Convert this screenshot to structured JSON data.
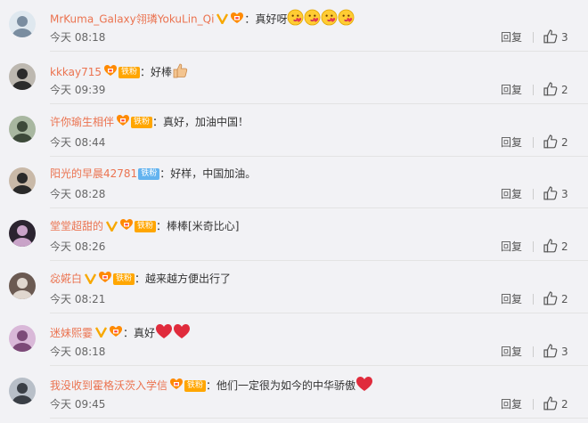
{
  "comments": [
    {
      "user": "MrKuma_Galaxy翎璘YokuLin_Qi",
      "verified": true,
      "fan_icon": true,
      "fan_label": "",
      "sep": "：",
      "text": "真好呀",
      "emojis": [
        "kiss",
        "kiss",
        "kiss",
        "kiss"
      ],
      "time": "今天 08:18",
      "reply": "回复",
      "likes": "3"
    },
    {
      "user": "kkkay715",
      "verified": false,
      "fan_icon": true,
      "fan_label": "铁粉",
      "sep": "：",
      "text": "好棒",
      "emojis": [
        "thumb"
      ],
      "time": "今天 09:39",
      "reply": "回复",
      "likes": "2"
    },
    {
      "user": "许你瑜生相伴",
      "verified": false,
      "fan_icon": true,
      "fan_label": "铁粉",
      "sep": "：",
      "text": "真好，加油中国！",
      "emojis": [],
      "time": "今天 08:44",
      "reply": "回复",
      "likes": "2"
    },
    {
      "user": "阳光的早晨42781",
      "verified": false,
      "fan_icon": false,
      "fan_label": "铁粉",
      "sep": "：",
      "text": "好样，中国加油。",
      "emojis": [],
      "time": "今天 08:28",
      "reply": "回复",
      "likes": "3"
    },
    {
      "user": "堂堂超甜的",
      "verified": true,
      "fan_icon": true,
      "fan_label": "铁粉",
      "sep": "：",
      "text": "棒棒[米奇比心]",
      "emojis": [],
      "time": "今天 08:26",
      "reply": "回复",
      "likes": "2"
    },
    {
      "user": "惢婲白",
      "verified": true,
      "fan_icon": true,
      "fan_label": "铁粉",
      "sep": "：",
      "text": "越来越方便出行了",
      "emojis": [],
      "time": "今天 08:21",
      "reply": "回复",
      "likes": "2"
    },
    {
      "user": "迷妹熙霎",
      "verified": true,
      "fan_icon": true,
      "fan_label": "",
      "sep": "：",
      "text": "真好",
      "emojis": [
        "heart",
        "heart"
      ],
      "time": "今天 08:18",
      "reply": "回复",
      "likes": "3"
    },
    {
      "user": "我没收到霍格沃茨入学信",
      "verified": false,
      "fan_icon": true,
      "fan_label": "铁粉",
      "sep": "：",
      "text": "他们一定很为如今的中华骄傲",
      "emojis": [
        "heart"
      ],
      "time": "今天 09:45",
      "reply": "回复",
      "likes": "2"
    }
  ],
  "colors": {
    "username": "#eb7350",
    "verified": "#f7a800",
    "fan_badge": "#ffa600",
    "fan_badge_blue": "#63b3ef",
    "background": "#f2f2f5"
  }
}
